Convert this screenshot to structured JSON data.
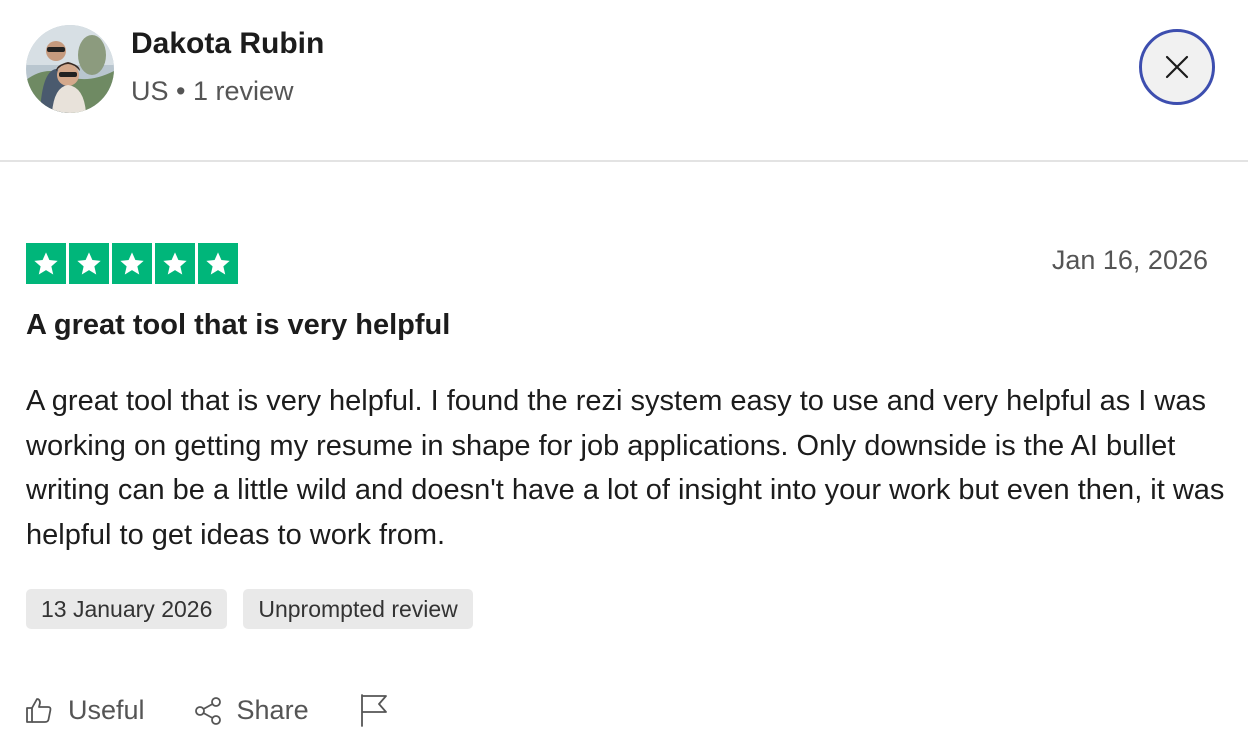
{
  "reviewer": {
    "name": "Dakota Rubin",
    "meta": "US • 1 review"
  },
  "review": {
    "rating": 5,
    "date": "Jan 16, 2026",
    "title": "A great tool that is very helpful",
    "body": "A great tool that is very helpful. I found the rezi system easy to use and very helpful as I was working on getting my resume in shape for job applications. Only downside is the AI bullet writing can be a little wild and doesn't have a lot of insight into your work but even then, it was helpful to get ideas to work from.",
    "tags": [
      "13 January 2026",
      "Unprompted review"
    ]
  },
  "actions": {
    "useful_label": "Useful",
    "share_label": "Share"
  },
  "colors": {
    "star_green": "#00b67a",
    "close_ring": "#3d4eaf",
    "tag_bg": "#e9e9e9"
  },
  "icons": [
    "close-icon",
    "star-icon",
    "thumbs-up-icon",
    "share-icon",
    "flag-icon"
  ]
}
